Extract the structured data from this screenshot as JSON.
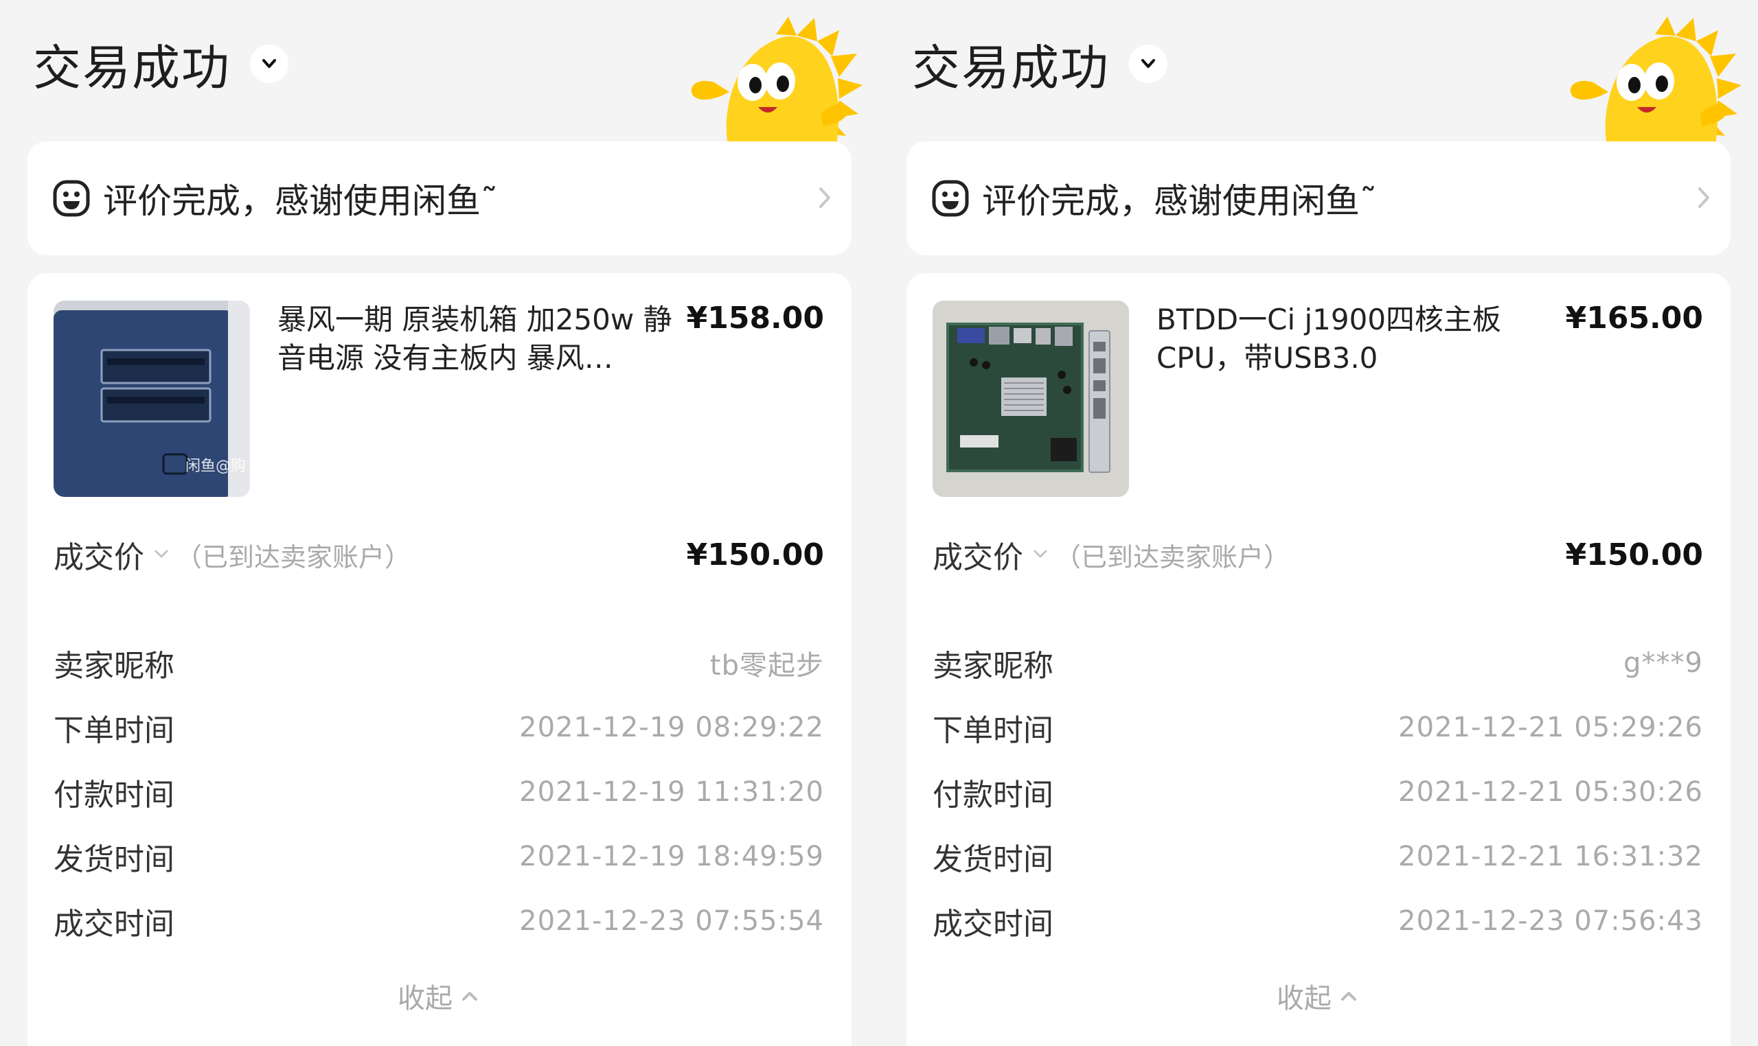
{
  "panels": [
    {
      "status_title": "交易成功",
      "review_text": "评价完成，感谢使用闲鱼˜",
      "product": {
        "title": "暴风一期 原装机箱 加250w 静音电源 没有主板内 暴风…",
        "price": "¥158.00",
        "image_watermark": "闲鱼@购"
      },
      "deal": {
        "label": "成交价",
        "note": "（已到达卖家账户）",
        "price": "¥150.00"
      },
      "info": [
        {
          "label": "卖家昵称",
          "value": "tb零起步"
        },
        {
          "label": "下单时间",
          "value": "2021-12-19 08:29:22"
        },
        {
          "label": "付款时间",
          "value": "2021-12-19 11:31:20"
        },
        {
          "label": "发货时间",
          "value": "2021-12-19 18:49:59"
        },
        {
          "label": "成交时间",
          "value": "2021-12-23 07:55:54"
        }
      ],
      "collapse_label": "收起"
    },
    {
      "status_title": "交易成功",
      "review_text": "评价完成，感谢使用闲鱼˜",
      "product": {
        "title": "BTDD一Ci j1900四核主板 CPU，带USB3.0",
        "price": "¥165.00"
      },
      "deal": {
        "label": "成交价",
        "note": "（已到达卖家账户）",
        "price": "¥150.00"
      },
      "info": [
        {
          "label": "卖家昵称",
          "value": "g***9"
        },
        {
          "label": "下单时间",
          "value": "2021-12-21 05:29:26"
        },
        {
          "label": "付款时间",
          "value": "2021-12-21 05:30:26"
        },
        {
          "label": "发货时间",
          "value": "2021-12-21 16:31:32"
        },
        {
          "label": "成交时间",
          "value": "2021-12-23 07:56:43"
        }
      ],
      "collapse_label": "收起"
    }
  ],
  "colors": {
    "background": "#f4f4f4",
    "card": "#ffffff",
    "primary_text": "#222222",
    "secondary_text": "#aaaaaa",
    "mascot_yellow": "#ffd21e"
  },
  "icons": {
    "status_toggle": "chevron-down-icon",
    "review": "smiley-icon",
    "review_arrow": "chevron-right-icon",
    "deal_toggle": "chevron-down-icon",
    "collapse": "chevron-up-icon",
    "mascot": "xianyu-fish-mascot"
  }
}
